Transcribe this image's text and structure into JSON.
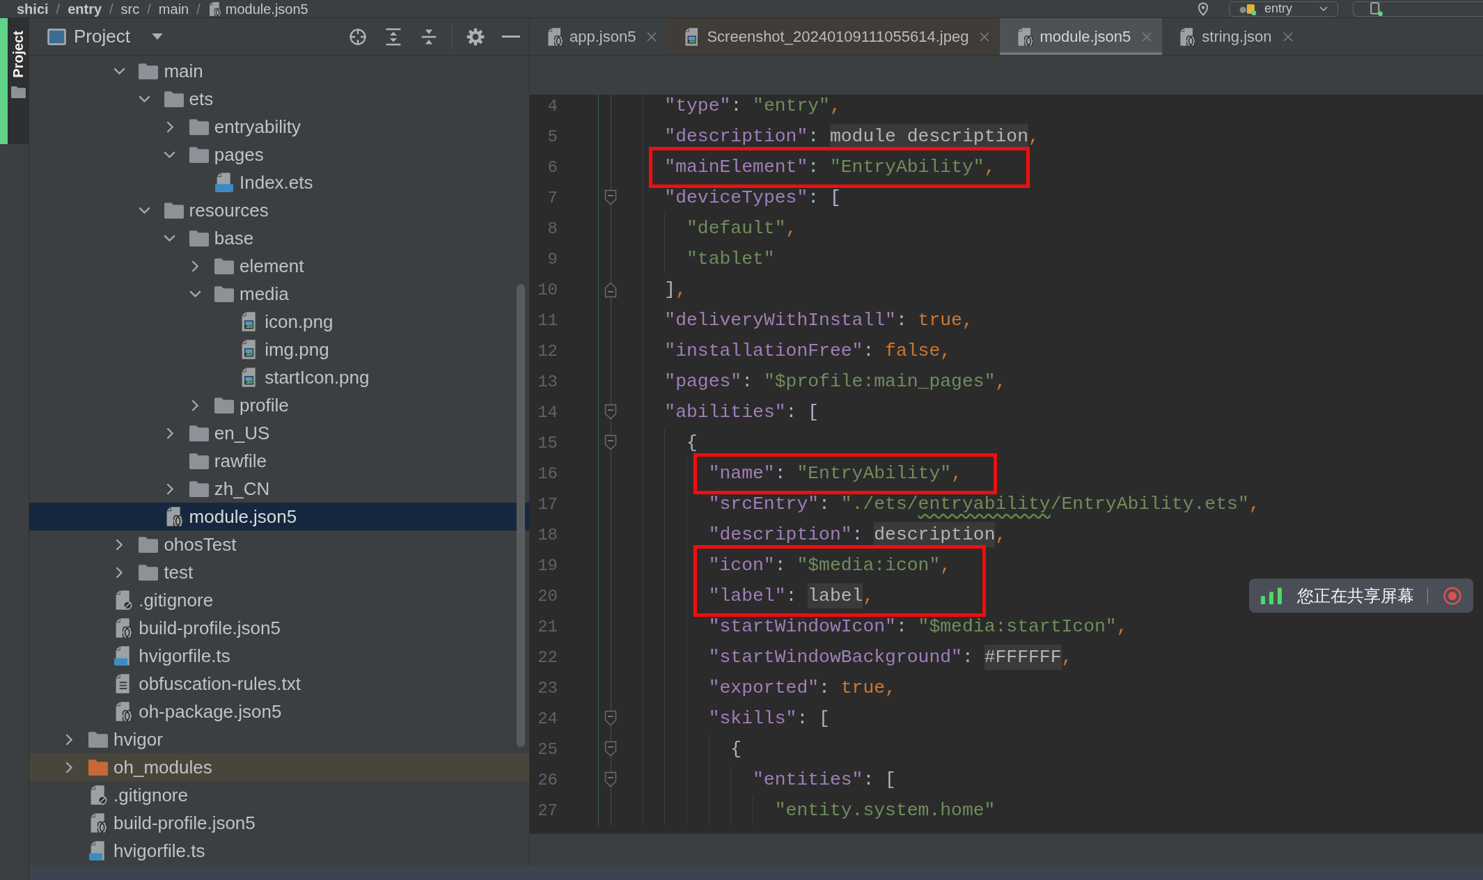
{
  "breadcrumbs": {
    "separator": "/",
    "items": [
      {
        "label": "shici",
        "kind": "project"
      },
      {
        "label": "entry",
        "kind": "module"
      },
      {
        "label": "src",
        "kind": "folder"
      },
      {
        "label": "main",
        "kind": "folder"
      },
      {
        "label": "module.json5",
        "kind": "json5"
      }
    ]
  },
  "run_config": {
    "label": "entry"
  },
  "stripe": {
    "label": "Project",
    "selected": true
  },
  "project_panel": {
    "title": "Project",
    "tree": [
      {
        "children": [
          {
            "children": [
              {
                "label": "main",
                "kind": "folder",
                "expanded": true,
                "selected": false,
                "children": [
                  {
                    "label": "ets",
                    "kind": "folder",
                    "expanded": true,
                    "selected": false,
                    "children": [
                      {
                        "label": "entryability",
                        "kind": "folder",
                        "expanded": false,
                        "selected": false
                      },
                      {
                        "label": "pages",
                        "kind": "folder",
                        "expanded": true,
                        "selected": false,
                        "children": [
                          {
                            "label": "Index.ets",
                            "kind": "ets",
                            "selected": false
                          }
                        ]
                      }
                    ]
                  },
                  {
                    "label": "resources",
                    "kind": "folder",
                    "expanded": true,
                    "selected": false,
                    "children": [
                      {
                        "label": "base",
                        "kind": "folder",
                        "expanded": true,
                        "selected": false,
                        "children": [
                          {
                            "label": "element",
                            "kind": "folder",
                            "expanded": false,
                            "selected": false
                          },
                          {
                            "label": "media",
                            "kind": "folder",
                            "expanded": true,
                            "selected": false,
                            "children": [
                              {
                                "label": "icon.png",
                                "kind": "image",
                                "selected": false
                              },
                              {
                                "label": "img.png",
                                "kind": "image",
                                "selected": false
                              },
                              {
                                "label": "startIcon.png",
                                "kind": "image",
                                "selected": false
                              }
                            ]
                          },
                          {
                            "label": "profile",
                            "kind": "folder",
                            "expanded": false,
                            "selected": false
                          }
                        ]
                      },
                      {
                        "label": "en_US",
                        "kind": "folder",
                        "expanded": false,
                        "selected": false
                      },
                      {
                        "label": "rawfile",
                        "kind": "folder",
                        "selected": false
                      },
                      {
                        "label": "zh_CN",
                        "kind": "folder",
                        "expanded": false,
                        "selected": false
                      }
                    ]
                  },
                  {
                    "label": "module.json5",
                    "kind": "json5",
                    "selected": true
                  }
                ]
              },
              {
                "label": "ohosTest",
                "kind": "folder",
                "expanded": false,
                "selected": false
              },
              {
                "label": "test",
                "kind": "folder",
                "expanded": false,
                "selected": false
              }
            ]
          },
          {
            "label": ".gitignore",
            "kind": "ignored",
            "selected": false
          },
          {
            "label": "build-profile.json5",
            "kind": "json5",
            "selected": false
          },
          {
            "label": "hvigorfile.ts",
            "kind": "ts",
            "selected": false
          },
          {
            "label": "obfuscation-rules.txt",
            "kind": "text",
            "selected": false
          },
          {
            "label": "oh-package.json5",
            "kind": "json5",
            "selected": false
          }
        ]
      },
      {
        "label": "hvigor",
        "kind": "folder",
        "expanded": false,
        "selected": false
      },
      {
        "label": "oh_modules",
        "kind": "library-folder",
        "expanded": false,
        "selected": false
      },
      {
        "label": ".gitignore",
        "kind": "ignored",
        "selected": false
      },
      {
        "label": "build-profile.json5",
        "kind": "json5",
        "selected": false
      },
      {
        "label": "hvigorfile.ts",
        "kind": "ts",
        "selected": false
      }
    ]
  },
  "tabs": [
    {
      "label": "app.json5",
      "kind": "json5",
      "selected": false
    },
    {
      "label": "Screenshot_20240109111055614.jpeg",
      "kind": "image",
      "selected": false
    },
    {
      "label": "module.json5",
      "kind": "json5",
      "selected": true
    },
    {
      "label": "string.json",
      "kind": "json5",
      "selected": false
    }
  ],
  "editor": {
    "lines": [
      {
        "children": [
          {
            "children": [
              {
                "number": "4",
                "kind": "plain",
                "boxed": false,
                "tokens": [
                  {
                    "kind": "key",
                    "text": "\"type\""
                  },
                  {
                    "kind": "punct",
                    "text": ": "
                  },
                  {
                    "kind": "string",
                    "text": "\"entry\""
                  },
                  {
                    "kind": "comma",
                    "text": ","
                  }
                ]
              },
              {
                "number": "5",
                "kind": "plain",
                "boxed": false,
                "tokens": [
                  {
                    "kind": "key",
                    "text": "\"description\""
                  },
                  {
                    "kind": "punct",
                    "text": ": "
                  },
                  {
                    "kind": "folded",
                    "text": "module description"
                  },
                  {
                    "kind": "comma",
                    "text": ","
                  }
                ]
              },
              {
                "number": "6",
                "kind": "plain",
                "boxed": true,
                "tokens": [
                  {
                    "kind": "key",
                    "text": "\"mainElement\""
                  },
                  {
                    "kind": "punct",
                    "text": ": "
                  },
                  {
                    "kind": "string",
                    "text": "\"EntryAbility\""
                  },
                  {
                    "kind": "comma",
                    "text": ","
                  }
                ]
              },
              {
                "number": "7",
                "kind": "fold-start",
                "boxed": false,
                "tokens": [
                  {
                    "kind": "key",
                    "text": "\"deviceTypes\""
                  },
                  {
                    "kind": "punct",
                    "text": ": ["
                  }
                ],
                "children": [
                  {
                    "number": "8",
                    "kind": "plain",
                    "boxed": false,
                    "tokens": [
                      {
                        "kind": "string",
                        "text": "\"default\""
                      },
                      {
                        "kind": "comma",
                        "text": ","
                      }
                    ]
                  },
                  {
                    "number": "9",
                    "kind": "plain",
                    "boxed": false,
                    "tokens": [
                      {
                        "kind": "string",
                        "text": "\"tablet\""
                      }
                    ]
                  }
                ]
              },
              {
                "number": "10",
                "kind": "fold-end",
                "boxed": false,
                "tokens": [
                  {
                    "kind": "punct",
                    "text": "]"
                  },
                  {
                    "kind": "comma",
                    "text": ","
                  }
                ]
              },
              {
                "number": "11",
                "kind": "plain",
                "boxed": false,
                "tokens": [
                  {
                    "kind": "key",
                    "text": "\"deliveryWithInstall\""
                  },
                  {
                    "kind": "punct",
                    "text": ": "
                  },
                  {
                    "kind": "literal",
                    "text": "true"
                  },
                  {
                    "kind": "comma",
                    "text": ","
                  }
                ]
              },
              {
                "number": "12",
                "kind": "plain",
                "boxed": false,
                "tokens": [
                  {
                    "kind": "key",
                    "text": "\"installationFree\""
                  },
                  {
                    "kind": "punct",
                    "text": ": "
                  },
                  {
                    "kind": "literal",
                    "text": "false"
                  },
                  {
                    "kind": "comma",
                    "text": ","
                  }
                ]
              },
              {
                "number": "13",
                "kind": "plain",
                "boxed": false,
                "tokens": [
                  {
                    "kind": "key",
                    "text": "\"pages\""
                  },
                  {
                    "kind": "punct",
                    "text": ": "
                  },
                  {
                    "kind": "string",
                    "text": "\"$profile:main_pages\""
                  },
                  {
                    "kind": "comma",
                    "text": ","
                  }
                ]
              },
              {
                "number": "14",
                "kind": "fold-start",
                "boxed": false,
                "tokens": [
                  {
                    "kind": "key",
                    "text": "\"abilities\""
                  },
                  {
                    "kind": "punct",
                    "text": ": ["
                  }
                ],
                "children": [
                  {
                    "number": "15",
                    "kind": "fold-start",
                    "boxed": false,
                    "tokens": [
                      {
                        "kind": "punct",
                        "text": "{"
                      }
                    ],
                    "children": [
                      {
                        "number": "16",
                        "kind": "plain",
                        "boxed": true,
                        "tokens": [
                          {
                            "kind": "key",
                            "text": "\"name\""
                          },
                          {
                            "kind": "punct",
                            "text": ": "
                          },
                          {
                            "kind": "string",
                            "text": "\"EntryAbility\""
                          },
                          {
                            "kind": "comma",
                            "text": ","
                          }
                        ]
                      },
                      {
                        "number": "17",
                        "kind": "plain",
                        "boxed": false,
                        "tokens": [
                          {
                            "kind": "key",
                            "text": "\"srcEntry\""
                          },
                          {
                            "kind": "punct",
                            "text": ": "
                          },
                          {
                            "kind": "string",
                            "text": "\"./ets/"
                          },
                          {
                            "kind": "typo",
                            "text": "entryability"
                          },
                          {
                            "kind": "string",
                            "text": "/EntryAbility.ets\""
                          },
                          {
                            "kind": "comma",
                            "text": ","
                          }
                        ]
                      },
                      {
                        "number": "18",
                        "kind": "plain",
                        "boxed": false,
                        "tokens": [
                          {
                            "kind": "key",
                            "text": "\"description\""
                          },
                          {
                            "kind": "punct",
                            "text": ": "
                          },
                          {
                            "kind": "folded",
                            "text": "description"
                          },
                          {
                            "kind": "comma",
                            "text": ","
                          }
                        ]
                      },
                      {
                        "number": "19",
                        "kind": "plain",
                        "boxed": true,
                        "tokens": [
                          {
                            "kind": "key",
                            "text": "\"icon\""
                          },
                          {
                            "kind": "punct",
                            "text": ": "
                          },
                          {
                            "kind": "string",
                            "text": "\"$media:icon\""
                          },
                          {
                            "kind": "comma",
                            "text": ","
                          }
                        ]
                      },
                      {
                        "number": "20",
                        "kind": "plain",
                        "boxed": true,
                        "tokens": [
                          {
                            "kind": "key",
                            "text": "\"label\""
                          },
                          {
                            "kind": "punct",
                            "text": ": "
                          },
                          {
                            "kind": "folded",
                            "text": "label"
                          },
                          {
                            "kind": "comma",
                            "text": ","
                          }
                        ]
                      },
                      {
                        "number": "21",
                        "kind": "plain",
                        "boxed": false,
                        "tokens": [
                          {
                            "kind": "key",
                            "text": "\"startWindowIcon\""
                          },
                          {
                            "kind": "punct",
                            "text": ": "
                          },
                          {
                            "kind": "string",
                            "text": "\"$media:startIcon\""
                          },
                          {
                            "kind": "comma",
                            "text": ","
                          }
                        ]
                      },
                      {
                        "number": "22",
                        "kind": "plain",
                        "boxed": false,
                        "tokens": [
                          {
                            "kind": "key",
                            "text": "\"startWindowBackground\""
                          },
                          {
                            "kind": "punct",
                            "text": ": "
                          },
                          {
                            "kind": "folded",
                            "text": "#FFFFFF"
                          },
                          {
                            "kind": "comma",
                            "text": ","
                          }
                        ]
                      },
                      {
                        "number": "23",
                        "kind": "plain",
                        "boxed": false,
                        "tokens": [
                          {
                            "kind": "key",
                            "text": "\"exported\""
                          },
                          {
                            "kind": "punct",
                            "text": ": "
                          },
                          {
                            "kind": "literal",
                            "text": "true"
                          },
                          {
                            "kind": "comma",
                            "text": ","
                          }
                        ]
                      },
                      {
                        "number": "24",
                        "kind": "fold-start",
                        "boxed": false,
                        "tokens": [
                          {
                            "kind": "key",
                            "text": "\"skills\""
                          },
                          {
                            "kind": "punct",
                            "text": ": ["
                          }
                        ],
                        "children": [
                          {
                            "number": "25",
                            "kind": "fold-start",
                            "boxed": false,
                            "tokens": [
                              {
                                "kind": "punct",
                                "text": "{"
                              }
                            ],
                            "children": [
                              {
                                "number": "26",
                                "kind": "fold-start",
                                "boxed": false,
                                "tokens": [
                                  {
                                    "kind": "key",
                                    "text": "\"entities\""
                                  },
                                  {
                                    "kind": "punct",
                                    "text": ": ["
                                  }
                                ],
                                "children": [
                                  {
                                    "number": "27",
                                    "kind": "plain",
                                    "boxed": false,
                                    "tokens": [
                                      {
                                        "kind": "string",
                                        "text": "\"entity.system.home\""
                                      }
                                    ]
                                  }
                                ]
                              }
                            ]
                          }
                        ]
                      }
                    ]
                  }
                ]
              }
            ]
          }
        ]
      }
    ]
  },
  "share_banner": {
    "label": "您正在共享屏幕"
  }
}
